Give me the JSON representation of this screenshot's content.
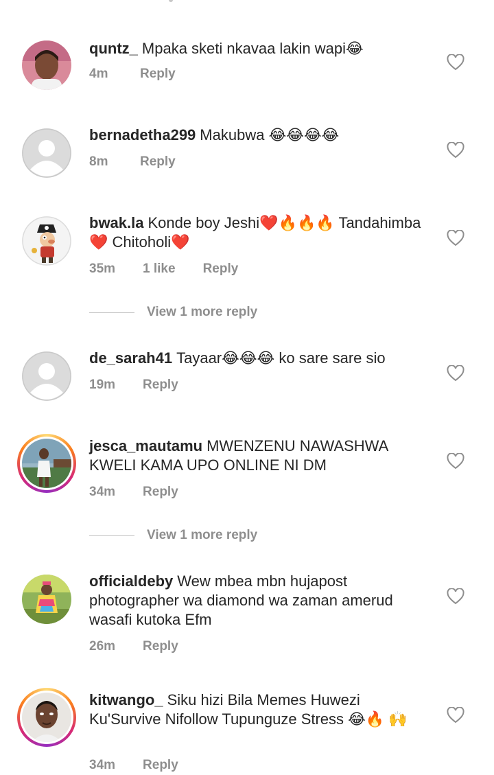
{
  "comments": [
    {
      "username": "quntz_",
      "text": "Mpaka sketi nkavaa lakin wapi😂",
      "time": "4m",
      "likes": "",
      "reply": "Reply",
      "avatar": "photo-woman-pink",
      "story": false
    },
    {
      "username": "bernadetha299",
      "text": "Makubwa 😂😂😂😂",
      "time": "8m",
      "likes": "",
      "reply": "Reply",
      "avatar": "default-avatar",
      "story": false
    },
    {
      "username": "bwak.la",
      "text": "Konde boy Jeshi❤️🔥🔥🔥 Tandahimba❤️ Chitoholi❤️",
      "time": "35m",
      "likes": "1 like",
      "reply": "Reply",
      "avatar": "cartoon-pirate",
      "story": false
    },
    {
      "username": "de_sarah41",
      "text": "Tayaar😂😂😂 ko sare sare sio",
      "time": "19m",
      "likes": "",
      "reply": "Reply",
      "avatar": "default-avatar",
      "story": false
    },
    {
      "username": "jesca_mautamu",
      "text": "MWENZENU NAWASHWA KWELI KAMA UPO ONLINE NI DM",
      "time": "34m",
      "likes": "",
      "reply": "Reply",
      "avatar": "photo-woman-lake",
      "story": true
    },
    {
      "username": "officialdeby",
      "text": "Wew mbea mbn hujapost photographer wa diamond wa zaman amerud wasafi kutoka Efm",
      "time": "26m",
      "likes": "",
      "reply": "Reply",
      "avatar": "photo-child-colorful",
      "story": false
    },
    {
      "username": "kitwango_",
      "text": "Siku hizi Bila Memes Huwezi Ku'Survive Nifollow Tupunguze Stress 😂🔥 🙌",
      "time": "34m",
      "likes": "",
      "reply": "Reply",
      "avatar": "photo-man-portrait",
      "story": true
    }
  ],
  "view_more": [
    "View 1 more reply",
    "View 1 more reply"
  ],
  "icons": {
    "like": "heart-outline-icon"
  },
  "colors": {
    "text": "#262626",
    "secondary": "#8e8e8e",
    "story_ring": "#d62976"
  }
}
